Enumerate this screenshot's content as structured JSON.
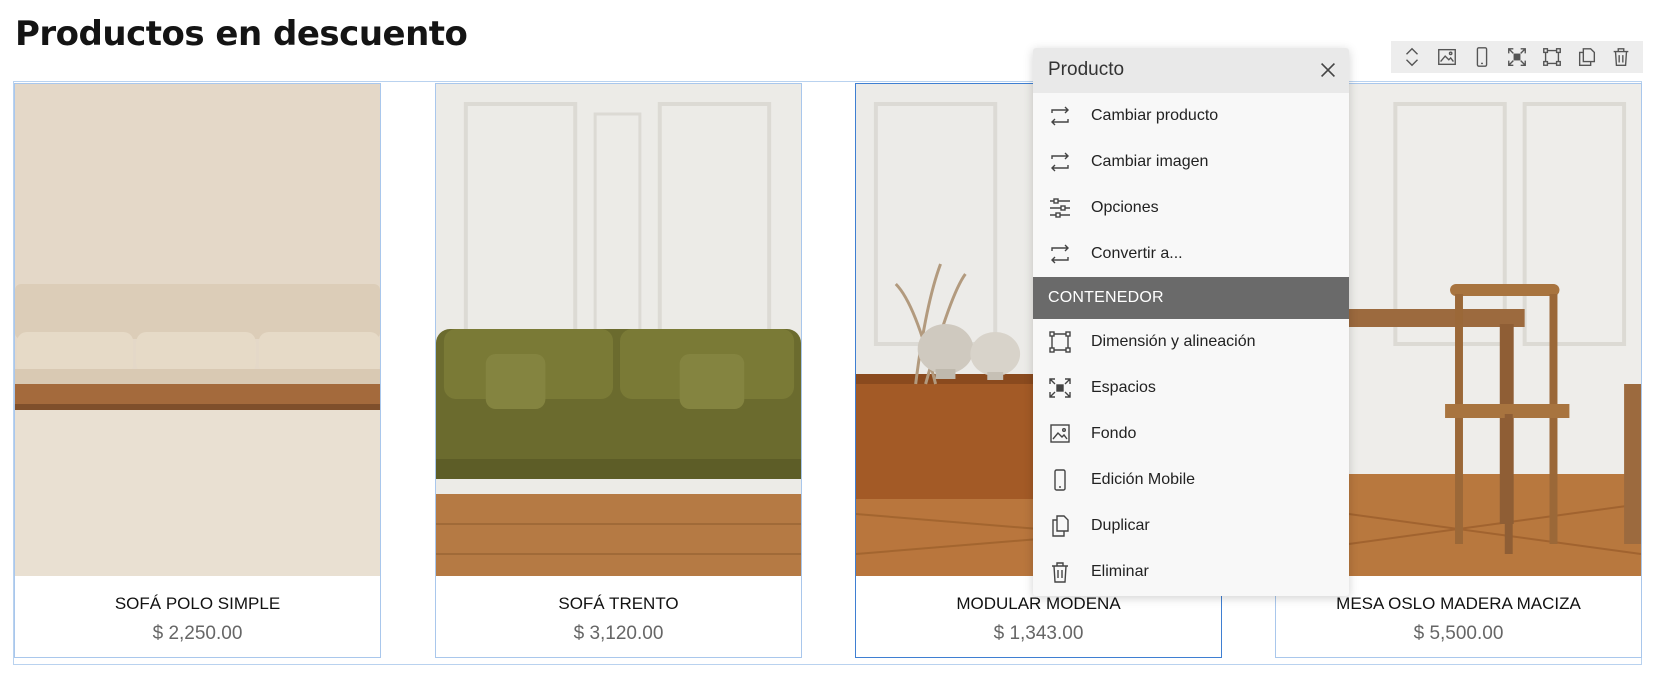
{
  "page": {
    "title": "Productos en descuento"
  },
  "products": [
    {
      "name": "SOFÁ POLO SIMPLE",
      "price": "$ 2,250.00"
    },
    {
      "name": "SOFÁ TRENTO",
      "price": "$ 3,120.00"
    },
    {
      "name": "MODULAR MODENA",
      "price": "$ 1,343.00"
    },
    {
      "name": "MESA OSLO MADERA MACIZA",
      "price": "$ 5,500.00"
    }
  ],
  "toolbar": {
    "icons": [
      "reorder-arrows-icon",
      "image-icon",
      "mobile-icon",
      "spacing-icon",
      "dimension-icon",
      "duplicate-icon",
      "trash-icon"
    ]
  },
  "menu": {
    "title": "Producto",
    "items": [
      {
        "label": "Cambiar producto",
        "icon": "swap-icon"
      },
      {
        "label": "Cambiar imagen",
        "icon": "swap-icon"
      },
      {
        "label": "Opciones",
        "icon": "sliders-icon"
      },
      {
        "label": "Convertir a...",
        "icon": "swap-icon"
      }
    ],
    "section_label": "CONTENEDOR",
    "container_items": [
      {
        "label": "Dimensión y alineación",
        "icon": "dimension-icon"
      },
      {
        "label": "Espacios",
        "icon": "spacing-icon"
      },
      {
        "label": "Fondo",
        "icon": "image-icon"
      },
      {
        "label": "Edición Mobile",
        "icon": "mobile-icon"
      },
      {
        "label": "Duplicar",
        "icon": "duplicate-icon"
      },
      {
        "label": "Eliminar",
        "icon": "trash-icon"
      }
    ]
  },
  "colors": {
    "card_border": "#a9c7ec",
    "selected_border": "#3f7fd2",
    "section_header": "#6a6a6a",
    "price_text": "#666666"
  }
}
